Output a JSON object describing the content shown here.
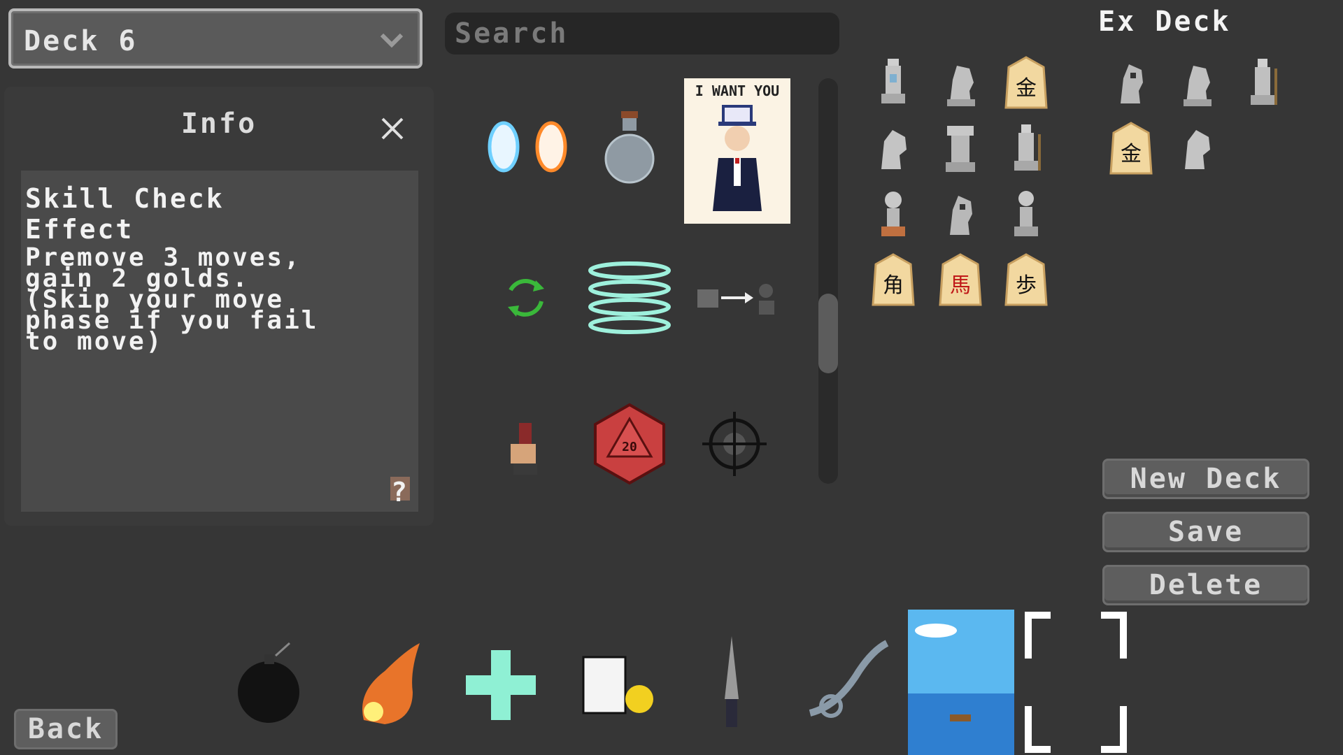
{
  "deck_selector": {
    "value": "Deck 6"
  },
  "search": {
    "placeholder": "Search"
  },
  "info": {
    "title": "Info",
    "card_name": "Skill Check",
    "section": "Effect",
    "description": "Premove 3 moves,\ngain 2 golds.\n(Skip your move\nphase if you fail\nto move)",
    "help": "?"
  },
  "cards": [
    {
      "icon": "portal-icon"
    },
    {
      "icon": "potion-icon"
    },
    {
      "icon": "uncle-sam-poster-icon",
      "text": "I WANT YOU"
    },
    {
      "icon": "recycle-icon"
    },
    {
      "icon": "whirlwind-icon"
    },
    {
      "icon": "piece-swap-icon"
    },
    {
      "icon": "hand-piece-icon"
    },
    {
      "icon": "d20-dice-icon",
      "text": "20"
    },
    {
      "icon": "crosshair-icon"
    }
  ],
  "ex_deck": {
    "title": "Ex Deck"
  },
  "main_pieces": [
    {
      "icon": "bishop-icon"
    },
    {
      "icon": "knight-icon"
    },
    {
      "icon": "shogi-gold-icon",
      "text": "金"
    },
    {
      "icon": "horse-head-icon"
    },
    {
      "icon": "rook-icon"
    },
    {
      "icon": "staff-bishop-icon"
    },
    {
      "icon": "pawn-icon"
    },
    {
      "icon": "grim-knight-icon"
    },
    {
      "icon": "pawn-icon"
    },
    {
      "icon": "shogi-bishop-icon",
      "text": "角"
    },
    {
      "icon": "shogi-horse-icon",
      "text": "馬"
    },
    {
      "icon": "shogi-pawn-icon",
      "text": "歩"
    }
  ],
  "ex_pieces": [
    {
      "icon": "grim-knight-icon"
    },
    {
      "icon": "knight-icon"
    },
    {
      "icon": "staff-bishop-icon"
    },
    {
      "icon": "shogi-gold-icon",
      "text": "金"
    },
    {
      "icon": "horse-head-icon"
    }
  ],
  "buttons": {
    "new_deck": "New Deck",
    "save": "Save",
    "delete": "Delete",
    "back": "Back"
  },
  "deck_cards": [
    {
      "icon": "bomb-icon"
    },
    {
      "icon": "fireball-icon"
    },
    {
      "icon": "heal-cross-icon"
    },
    {
      "icon": "contract-gold-icon"
    },
    {
      "icon": "dagger-icon"
    },
    {
      "icon": "wind-gust-icon"
    },
    {
      "icon": "sea-scene-icon"
    },
    {
      "icon": "empty-slot-icon"
    }
  ],
  "colors": {
    "background": "#363636",
    "panel": "#3a3a3a",
    "button": "#5e5e5e"
  }
}
